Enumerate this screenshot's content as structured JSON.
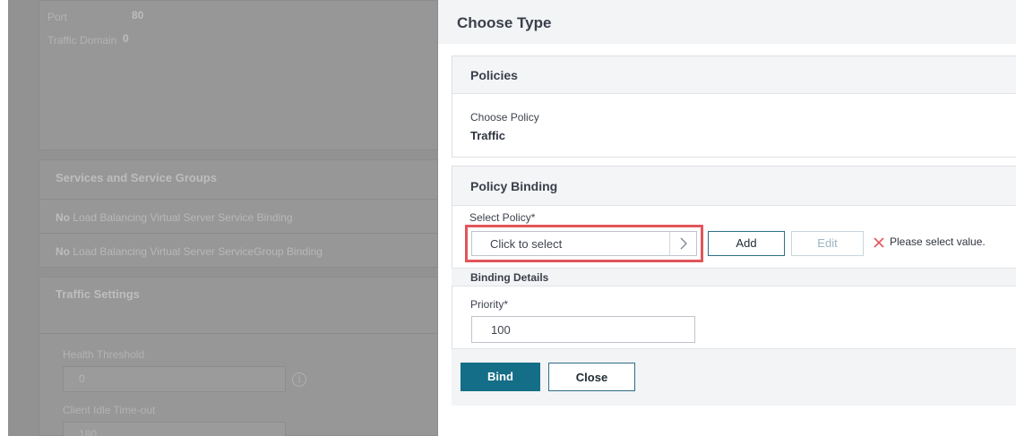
{
  "background": {
    "port_label": "Port",
    "port_value": "80",
    "traffic_domain_label": "Traffic Domain",
    "traffic_domain_value": "0",
    "services_title": "Services and Service Groups",
    "service_binding_prefix": "No",
    "service_binding_text": "Load Balancing Virtual Server Service Binding",
    "servicegroup_binding_prefix": "No",
    "servicegroup_binding_text": "Load Balancing Virtual Server ServiceGroup Binding",
    "traffic_settings_title": "Traffic Settings",
    "health_threshold_label": "Health Threshold",
    "health_threshold_value": "0",
    "client_idle_label": "Client Idle Time-out",
    "client_idle_value": "180",
    "info_icon": "info-icon"
  },
  "dialog": {
    "title": "Choose Type",
    "policies": {
      "title": "Policies",
      "choose_policy_label": "Choose Policy",
      "choose_policy_value": "Traffic"
    },
    "binding": {
      "title": "Policy Binding",
      "select_policy_label": "Select Policy*",
      "select_placeholder": "Click to select",
      "select_icon": "chevron-right-icon",
      "add_label": "Add",
      "edit_label": "Edit",
      "error_icon": "close-x-icon",
      "error_text": "Please select value.",
      "binding_details_title": "Binding Details",
      "priority_label": "Priority*",
      "priority_value": "100"
    },
    "footer": {
      "bind_label": "Bind",
      "close_label": "Close"
    }
  },
  "colors": {
    "primary": "#146e87",
    "highlight": "#e2565a",
    "error": "#e2565a",
    "overlay": "#929292"
  }
}
